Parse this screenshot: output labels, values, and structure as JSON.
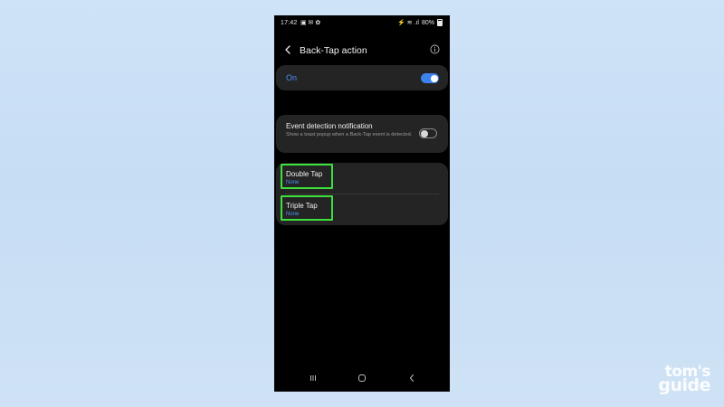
{
  "status_bar": {
    "time": "17:42",
    "left_icons": "▣ ✉ ✿",
    "signal_icons": "⚡ ≋ .ıl",
    "battery": "80%"
  },
  "header": {
    "title": "Back-Tap action"
  },
  "main_toggle": {
    "label": "On",
    "state": true,
    "color": "#3e82ee"
  },
  "event_notification": {
    "title": "Event detection notification",
    "description": "Show a toast popup when a Back-Tap event is detected.",
    "state": false
  },
  "tap_actions": [
    {
      "title": "Double Tap",
      "value": "None"
    },
    {
      "title": "Triple Tap",
      "value": "None"
    }
  ],
  "highlight_color": "#3ee03e",
  "watermark": {
    "line1": "tom's",
    "line2": "guide"
  },
  "icons": {
    "back": "back-arrow-icon",
    "info": "info-icon",
    "nav_recents": "recents-icon",
    "nav_home": "home-icon",
    "nav_back": "nav-back-icon"
  }
}
